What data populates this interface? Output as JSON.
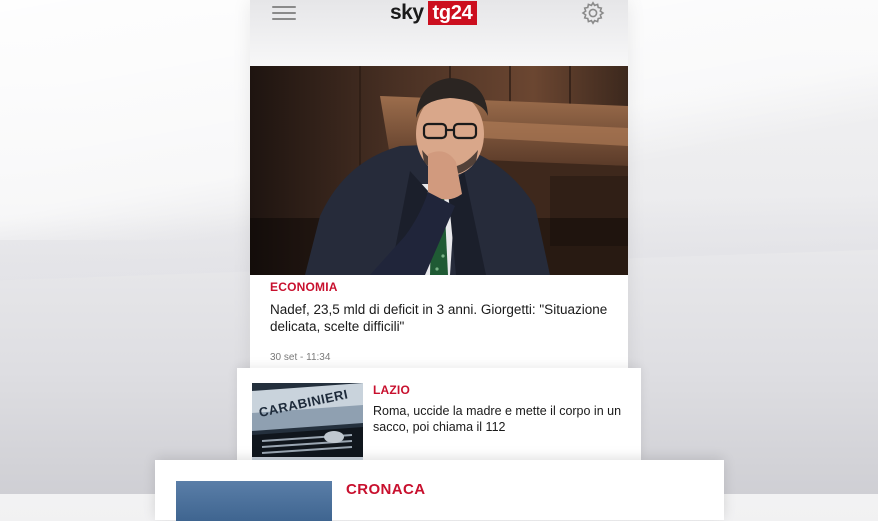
{
  "header": {
    "logo_sky": "sky",
    "logo_tg": "tg24",
    "menu_icon": "hamburger-menu-icon",
    "settings_icon": "gear-icon"
  },
  "colors": {
    "brand_red": "#cc0f1f",
    "kicker_red": "#c8102e"
  },
  "hero_article": {
    "category": "ECONOMIA",
    "title": "Nadef, 23,5 mld di deficit in 3 anni. Giorgetti: \"Situazione delicata, scelte difficili\"",
    "timestamp": "30 set - 11:34"
  },
  "articles": [
    {
      "category": "LAZIO",
      "title": "Roma, uccide la madre e mette il corpo in un sacco, poi chiama il 112",
      "thumb_text": "CARABINIERI"
    },
    {
      "category": "CRONACA"
    }
  ]
}
